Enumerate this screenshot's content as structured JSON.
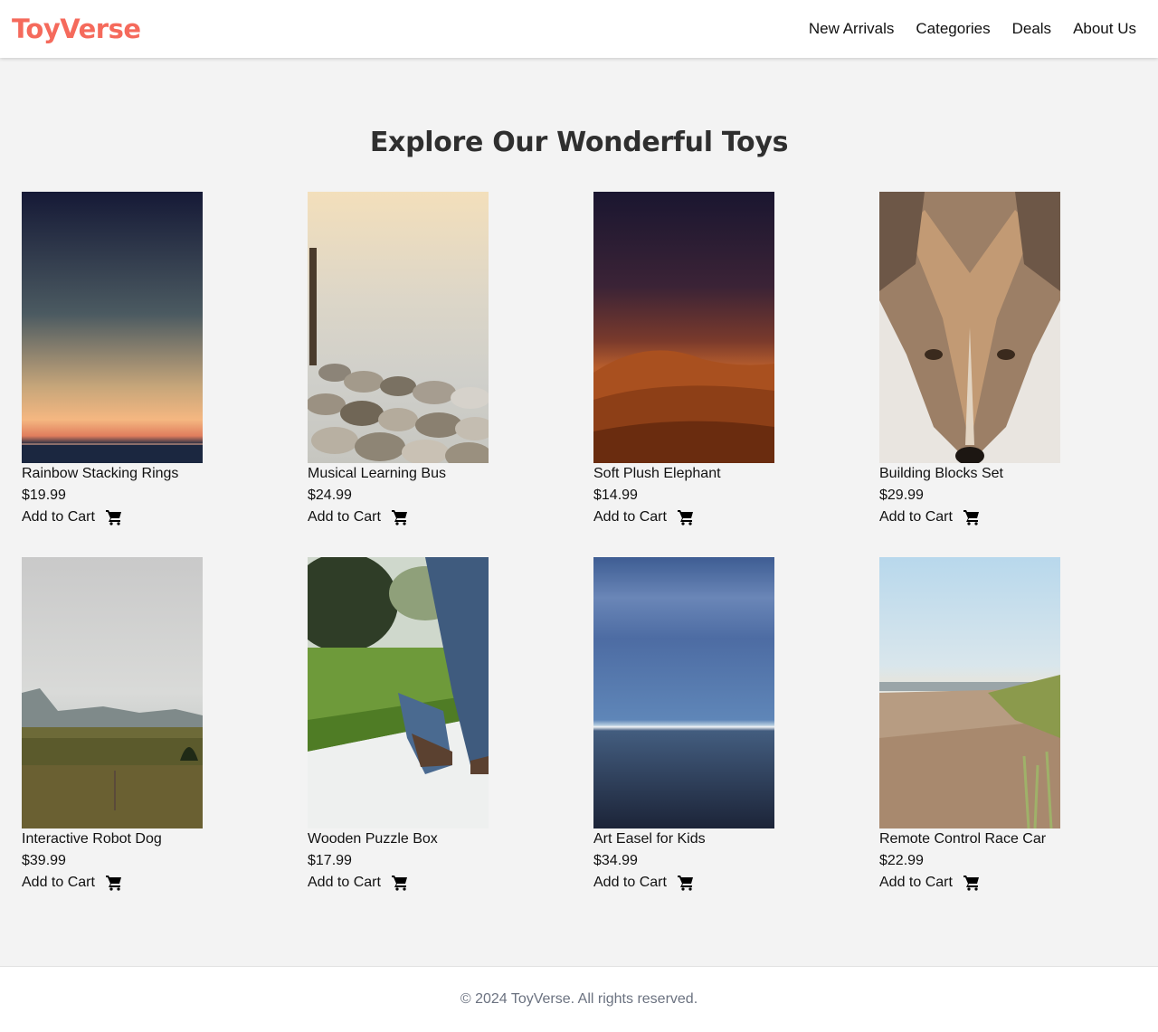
{
  "header": {
    "logo": "ToyVerse",
    "logo_color": "#f56a5c",
    "nav": [
      {
        "label": "New Arrivals"
      },
      {
        "label": "Categories"
      },
      {
        "label": "Deals"
      },
      {
        "label": "About Us"
      }
    ]
  },
  "main": {
    "title": "Explore Our Wonderful Toys",
    "products": [
      {
        "name": "Rainbow Stacking Rings",
        "price": "$19.99",
        "cta": "Add to Cart",
        "image": "sunset-sea-photo"
      },
      {
        "name": "Musical Learning Bus",
        "price": "$24.99",
        "cta": "Add to Cart",
        "image": "stones-fog-photo"
      },
      {
        "name": "Soft Plush Elephant",
        "price": "$14.99",
        "cta": "Add to Cart",
        "image": "desert-dune-photo"
      },
      {
        "name": "Building Blocks Set",
        "price": "$29.99",
        "cta": "Add to Cart",
        "image": "coyote-photo"
      },
      {
        "name": "Interactive Robot Dog",
        "price": "$39.99",
        "cta": "Add to Cart",
        "image": "meadow-mountains-photo"
      },
      {
        "name": "Wooden Puzzle Box",
        "price": "$17.99",
        "cta": "Add to Cart",
        "image": "walking-legs-photo"
      },
      {
        "name": "Art Easel for Kids",
        "price": "$34.99",
        "cta": "Add to Cart",
        "image": "ocean-horizon-photo"
      },
      {
        "name": "Remote Control Race Car",
        "price": "$22.99",
        "cta": "Add to Cart",
        "image": "beach-grass-photo"
      }
    ]
  },
  "footer": {
    "text": "© 2024 ToyVerse. All rights reserved."
  },
  "icons": {
    "cart": "shopping-cart-icon"
  }
}
